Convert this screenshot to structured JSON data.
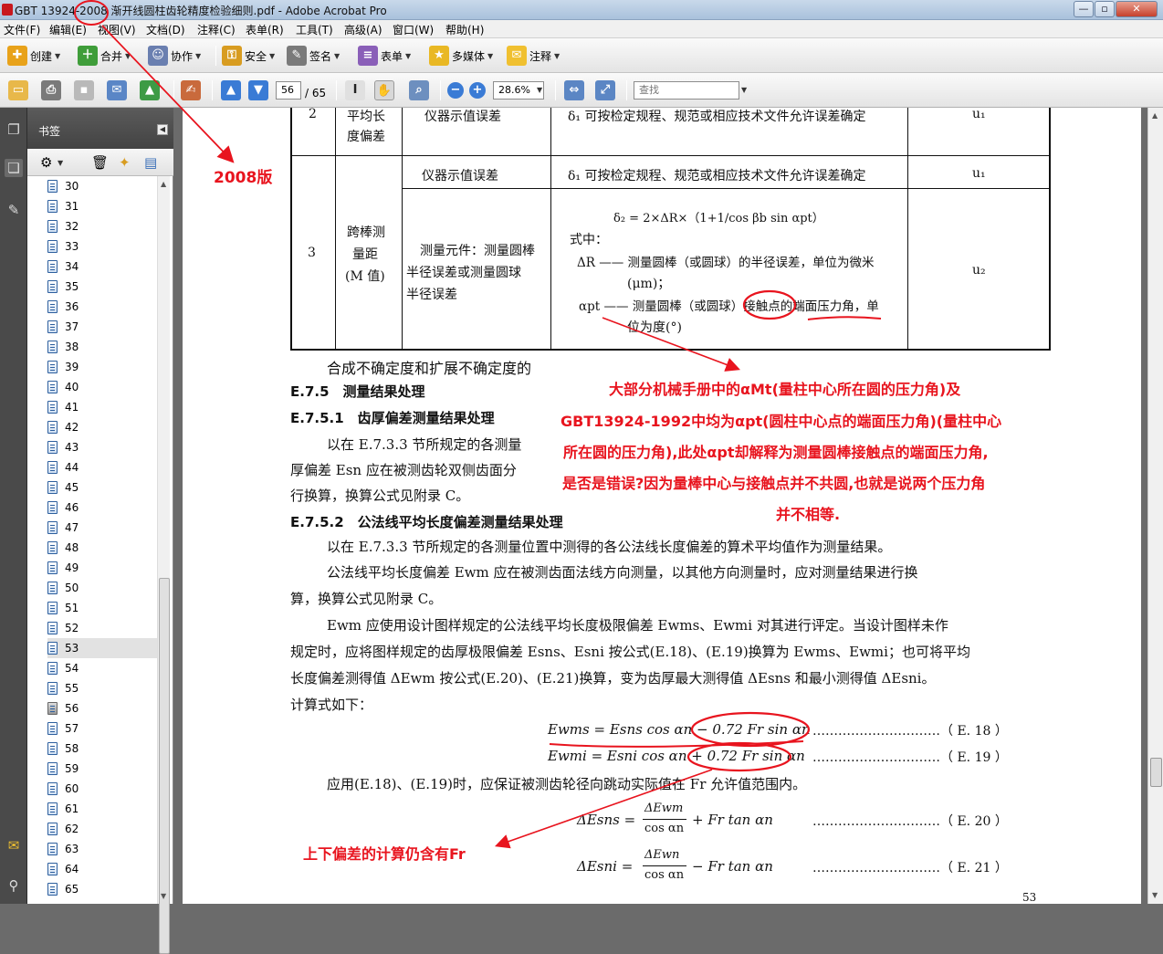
{
  "window": {
    "title": "GBT 13924-2008 渐开线圆柱齿轮精度检验细则.pdf - Adobe Acrobat Pro",
    "btn_min": "—",
    "btn_max": "▫",
    "btn_close": "✕"
  },
  "menu": [
    "文件(F)",
    "编辑(E)",
    "视图(V)",
    "文档(D)",
    "注释(C)",
    "表单(R)",
    "工具(T)",
    "高级(A)",
    "窗口(W)",
    "帮助(H)"
  ],
  "toolbar1": {
    "create": "创建",
    "combine": "合并",
    "collaborate": "协作",
    "secure": "安全",
    "sign": "签名",
    "forms": "表单",
    "multimedia": "多媒体",
    "comment": "注释"
  },
  "toolbar2": {
    "page_current": "56",
    "page_total": "/ 65",
    "zoom": "28.6%",
    "find_placeholder": "查找"
  },
  "bookmarks": {
    "header": "书签",
    "items": [
      "30",
      "31",
      "32",
      "33",
      "34",
      "35",
      "36",
      "37",
      "38",
      "39",
      "40",
      "41",
      "42",
      "43",
      "44",
      "45",
      "46",
      "47",
      "48",
      "49",
      "50",
      "51",
      "52",
      "53",
      "54",
      "55",
      "56",
      "57",
      "58",
      "59",
      "60",
      "61",
      "62",
      "63",
      "64",
      "65"
    ],
    "selected": "53"
  },
  "doc": {
    "table": {
      "r2_no": "2",
      "r2_name_a": "平均长",
      "r2_name_b": "度偏差",
      "r2_src": "仪器示值误差",
      "r2_desc": "δ₁ 可按检定规程、规范或相应技术文件允许误差确定",
      "r2_u": "u₁",
      "r3_no": "3",
      "r3_name_a": "跨棒测",
      "r3_name_b": "量距",
      "r3_name_c": "(M 值)",
      "r3a_src": "仪器示值误差",
      "r3a_desc": "δ₁ 可按检定规程、规范或相应技术文件允许误差确定",
      "r3a_u": "u₁",
      "r3b_src_a": "测量元件：测量圆棒",
      "r3b_src_b": "半径误差或测量圆球",
      "r3b_src_c": "半径误差",
      "r3b_formula": "δ₂ = 2×ΔR×（1+1/cos βb sin αpt）",
      "r3b_l1": "式中：",
      "r3b_l2": "ΔR —— 测量圆棒（或圆球）的半径误差，单位为微米",
      "r3b_l3": "(μm)；",
      "r3b_l4": "αpt —— 测量圆棒（或圆球）接触点的端面压力角，单",
      "r3b_l5": "位为度(°)",
      "r3b_u": "u₂"
    },
    "p_synth": "合成不确定度和扩展不确定度的",
    "h_e75": "E.7.5　测量结果处理",
    "h_e751": "E.7.5.1　齿厚偏差测量结果处理",
    "p1_l1": "以在 E.7.3.3 节所规定的各测量",
    "p1_l2": "厚偏差 Esn 应在被测齿轮双侧齿面分",
    "p1_l3": "行换算，换算公式见附录 C。",
    "h_e752": "E.7.5.2　公法线平均长度偏差测量结果处理",
    "p2_l1": "以在 E.7.3.3 节所规定的各测量位置中测得的各公法线长度偏差的算术平均值作为测量结果。",
    "p3_l1": "公法线平均长度偏差 Ewm 应在被测齿面法线方向测量，以其他方向测量时，应对测量结果进行换",
    "p3_l2": "算，换算公式见附录 C。",
    "p4_l1": "Ewm 应使用设计图样规定的公法线平均长度极限偏差 Ewms、Ewmi 对其进行评定。当设计图样未作",
    "p4_l2": "规定时，应将图样规定的齿厚极限偏差 Esns、Esni 按公式(E.18)、(E.19)换算为 Ewms、Ewmi；也可将平均",
    "p4_l3": "长度偏差测得值 ΔEwm 按公式(E.20)、(E.21)换算，变为齿厚最大测得值 ΔEsns 和最小测得值 ΔEsni。",
    "p4_l4": "计算式如下：",
    "eq18": "Ewms = Esns cos αn − 0.72 Fr sin αn",
    "eq18_no": "…………………………（ E. 18 ）",
    "eq19": "Ewmi = Esni cos αn + 0.72 Fr sin αn",
    "eq19_no": "…………………………（ E. 19 ）",
    "p5": "应用(E.18)、(E.19)时，应保证被测齿轮径向跳动实际值在 Fr 允许值范围内。",
    "eq20_lhs": "ΔEsns =",
    "eq20_num": "ΔEwm",
    "eq20_den": "cos αn",
    "eq20_rhs": "+ Fr tan αn",
    "eq20_no": "…………………………（ E. 20 ）",
    "eq21_lhs": "ΔEsni =",
    "eq21_num": "ΔEwn",
    "eq21_den": "cos αn",
    "eq21_rhs": "− Fr tan αn",
    "eq21_no": "…………………………（ E. 21 ）",
    "page_no": "53"
  },
  "annotations": {
    "a2008": "2008版",
    "main_1": "大部分机械手册中的αMt(量柱中心所在圆的压力角)及",
    "main_2": "GBT13924-1992中均为αpt(圆柱中心点的端面压力角)(量柱中心",
    "main_3": "所在圆的压力角),此处αpt却解释为测量圆棒接触点的端面压力角,",
    "main_4": "是否是错误?因为量棒中心与接触点并不共圆,也就是说两个压力角",
    "main_5": "并不相等.",
    "fr_note": "上下偏差的计算仍含有Fr"
  },
  "colors": {
    "annotation": "#e8141e"
  }
}
